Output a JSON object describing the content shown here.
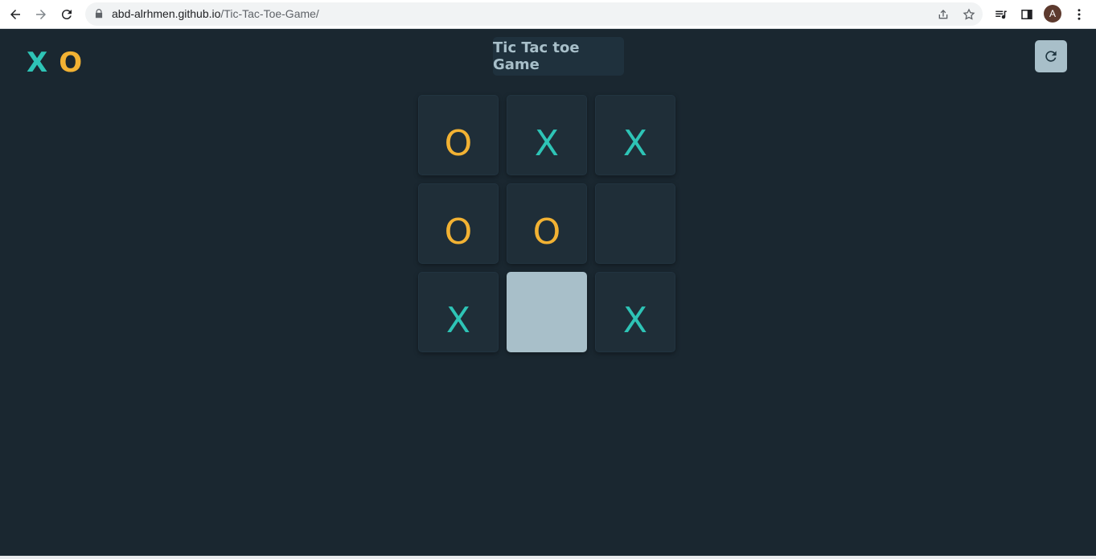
{
  "browser": {
    "url_host": "abd-alrhmen.github.io",
    "url_path": "/Tic-Tac-Toe-Game/",
    "avatar_letter": "A",
    "icons": [
      "back-icon",
      "forward-icon",
      "reload-icon",
      "lock-icon",
      "share-icon",
      "star-icon",
      "media-icon",
      "side-panel-icon",
      "menu-icon"
    ]
  },
  "page": {
    "logo_x": "X",
    "logo_o": "O",
    "title": "Tic Tac toe Game",
    "restart_icon": "restart-icon"
  },
  "board": {
    "cells": [
      "O",
      "X",
      "X",
      "O",
      "O",
      "",
      "X",
      "",
      "X"
    ],
    "hovered_cell": 7
  },
  "colors": {
    "background": "#1a2730",
    "x": "#2ec4b6",
    "o": "#f2b233",
    "silver": "#a8bfc9"
  }
}
